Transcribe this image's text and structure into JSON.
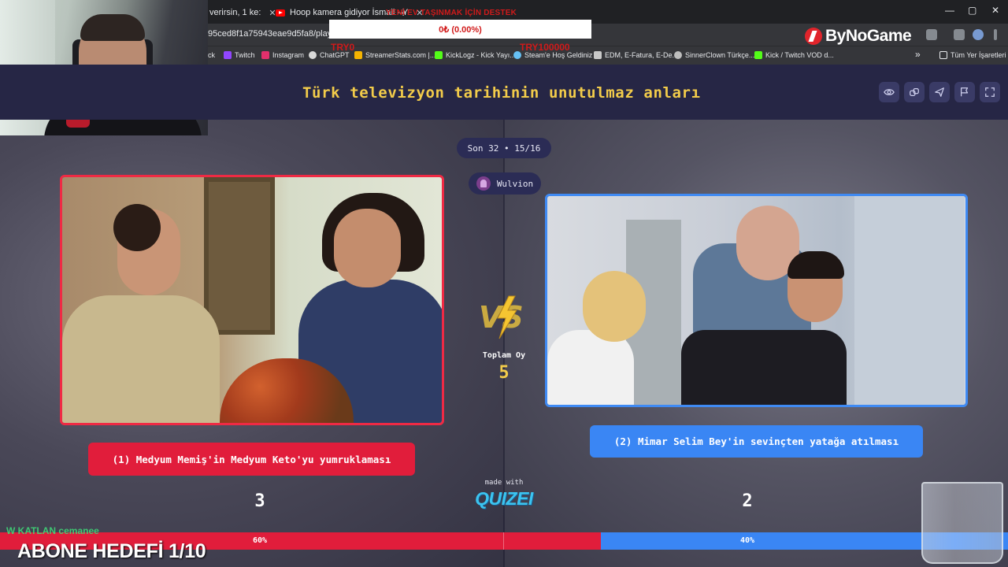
{
  "browser": {
    "tabs": [
      {
        "title": "verirsin, 1 ke:",
        "close": "✕"
      },
      {
        "title": "Hoop kamera gidiyor İsmail - Y",
        "close": "✕"
      }
    ],
    "new_tab": "+",
    "window_controls": [
      "—",
      "▢",
      "✕"
    ],
    "url": "95ced8f1a75943eae9d5fa8/play",
    "bookmarks": [
      {
        "label": "ck",
        "color": "#e8eaed"
      },
      {
        "label": "Twitch",
        "color": "#9146ff"
      },
      {
        "label": "Instagram",
        "color": "#e1306c"
      },
      {
        "label": "ChatGPT",
        "color": "#d9d9d9"
      },
      {
        "label": "StreamerStats.com |...",
        "color": "#f5b400"
      },
      {
        "label": "KickLogz - Kick Yayı...",
        "color": "#53fc18"
      },
      {
        "label": "Steam'e Hoş Geldiniz",
        "color": "#66c0f4"
      },
      {
        "label": "EDM, E-Fatura, E-De...",
        "color": "#c9c9c9"
      },
      {
        "label": "SinnerClown Türkçe...",
        "color": "#bdbdbd"
      },
      {
        "label": "Kick / Twitch VOD d...",
        "color": "#53fc18"
      }
    ],
    "bookmarks_overflow": "»",
    "all_bookmarks": "Tüm Yer İşaretleri"
  },
  "donation": {
    "title": "YENİ EV TAŞINMAK İÇİN DESTEK",
    "amount": "0₺ (0.00%)",
    "min": "TRY0",
    "max": "TRY100000"
  },
  "sponsor": {
    "name": "ByNoGame"
  },
  "quiz": {
    "title": "Türk televizyon tarihinin unutulmaz anları",
    "round": "Son 32 • 15/16",
    "user": "Wulvion",
    "total_label": "Toplam Oy",
    "total_votes": "5",
    "left": {
      "caption": "(1) Medyum Memiş'in Medyum Keto'yu yumruklaması",
      "votes": "3",
      "percent_label": "60%",
      "percent": 60
    },
    "right": {
      "caption": "(2) Mimar Selim Bey'in sevinçten yatağa atılması",
      "votes": "2",
      "percent_label": "40%",
      "percent": 40
    },
    "made_with": "made with",
    "brand": "QUIZEI",
    "colors": {
      "left": "#e11d3b",
      "right": "#3a86f4",
      "title": "#f3cc4a"
    }
  },
  "overlay": {
    "chat": "W KATLAN cemanee",
    "goal": "ABONE HEDEFİ 1/10"
  }
}
